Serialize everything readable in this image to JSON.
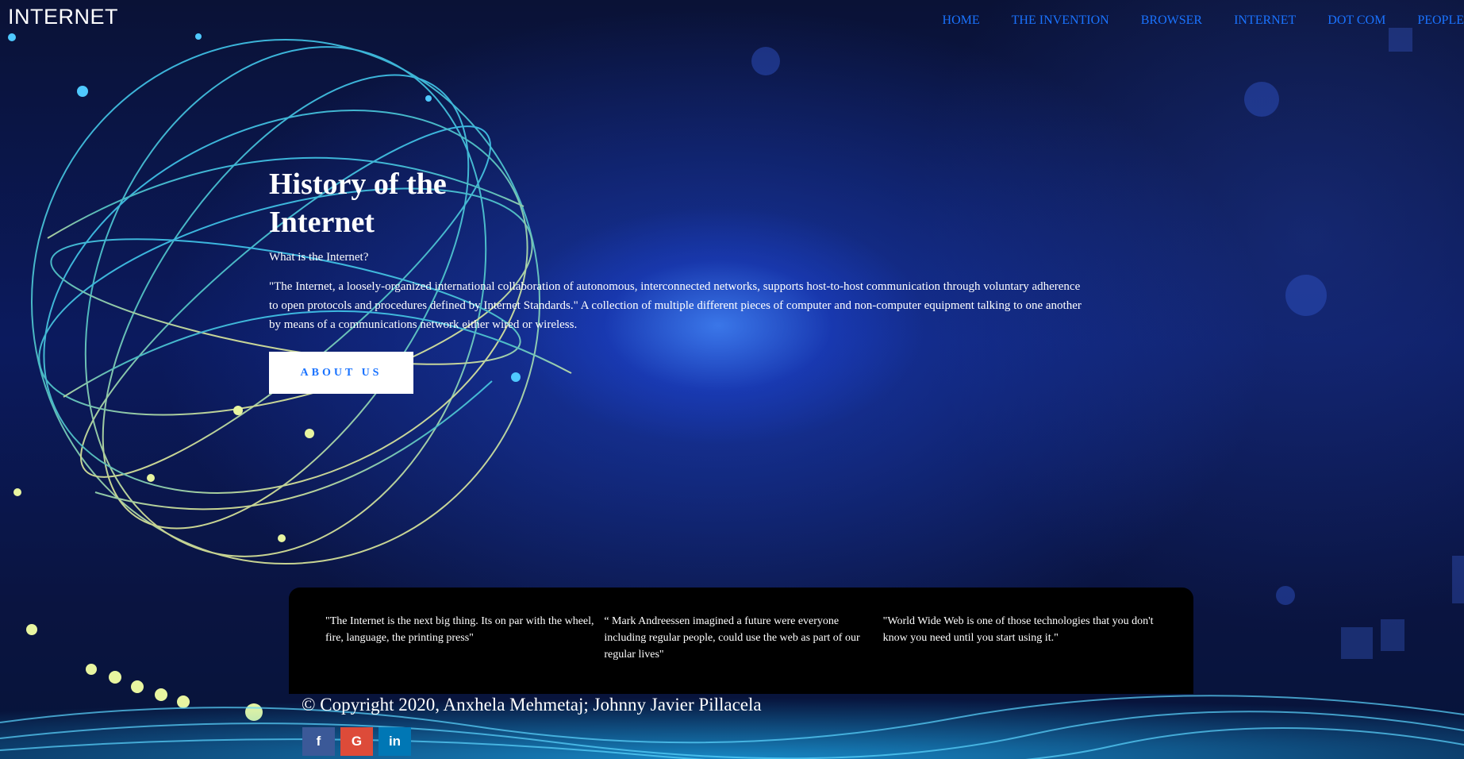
{
  "header": {
    "logo": "INTERNET",
    "nav": [
      "HOME",
      "THE INVENTION",
      "BROWSER",
      "INTERNET",
      "DOT COM",
      "PEOPLE"
    ]
  },
  "hero": {
    "title": "History of the Internet",
    "subtitle": "What is the Internet?",
    "description": "\"The Internet, a loosely-organized international collaboration of autonomous, interconnected networks, supports host-to-host communication through voluntary adherence to open protocols and procedures defined by Internet Standards.\" A collection of multiple different pieces of computer and non-computer equipment talking to one another by means of a communications network either wired or wireless.",
    "button_label": "ABOUT US"
  },
  "quotes": [
    "\"The Internet is the next big thing. Its on par with the wheel, fire, language, the printing press\"",
    "“ Mark Andreessen imagined a future were everyone including regular people, could use the web as part of our regular lives\"",
    "\"World Wide Web is one of those technologies that you don't know you need until you start using it.\""
  ],
  "footer": {
    "copyright": "© Copyright 2020, Anxhela Mehmetaj; Johnny Javier Pillacela",
    "social": [
      {
        "icon": "facebook-icon",
        "glyph": "f",
        "color": "#3b5998"
      },
      {
        "icon": "google-icon",
        "glyph": "G",
        "color": "#dd4b39"
      },
      {
        "icon": "linkedin-icon",
        "glyph": "in",
        "color": "#0077b5"
      }
    ]
  },
  "colors": {
    "nav_link": "#1a73ff",
    "button_text": "#1a73ff",
    "quote_bg": "#000000"
  }
}
